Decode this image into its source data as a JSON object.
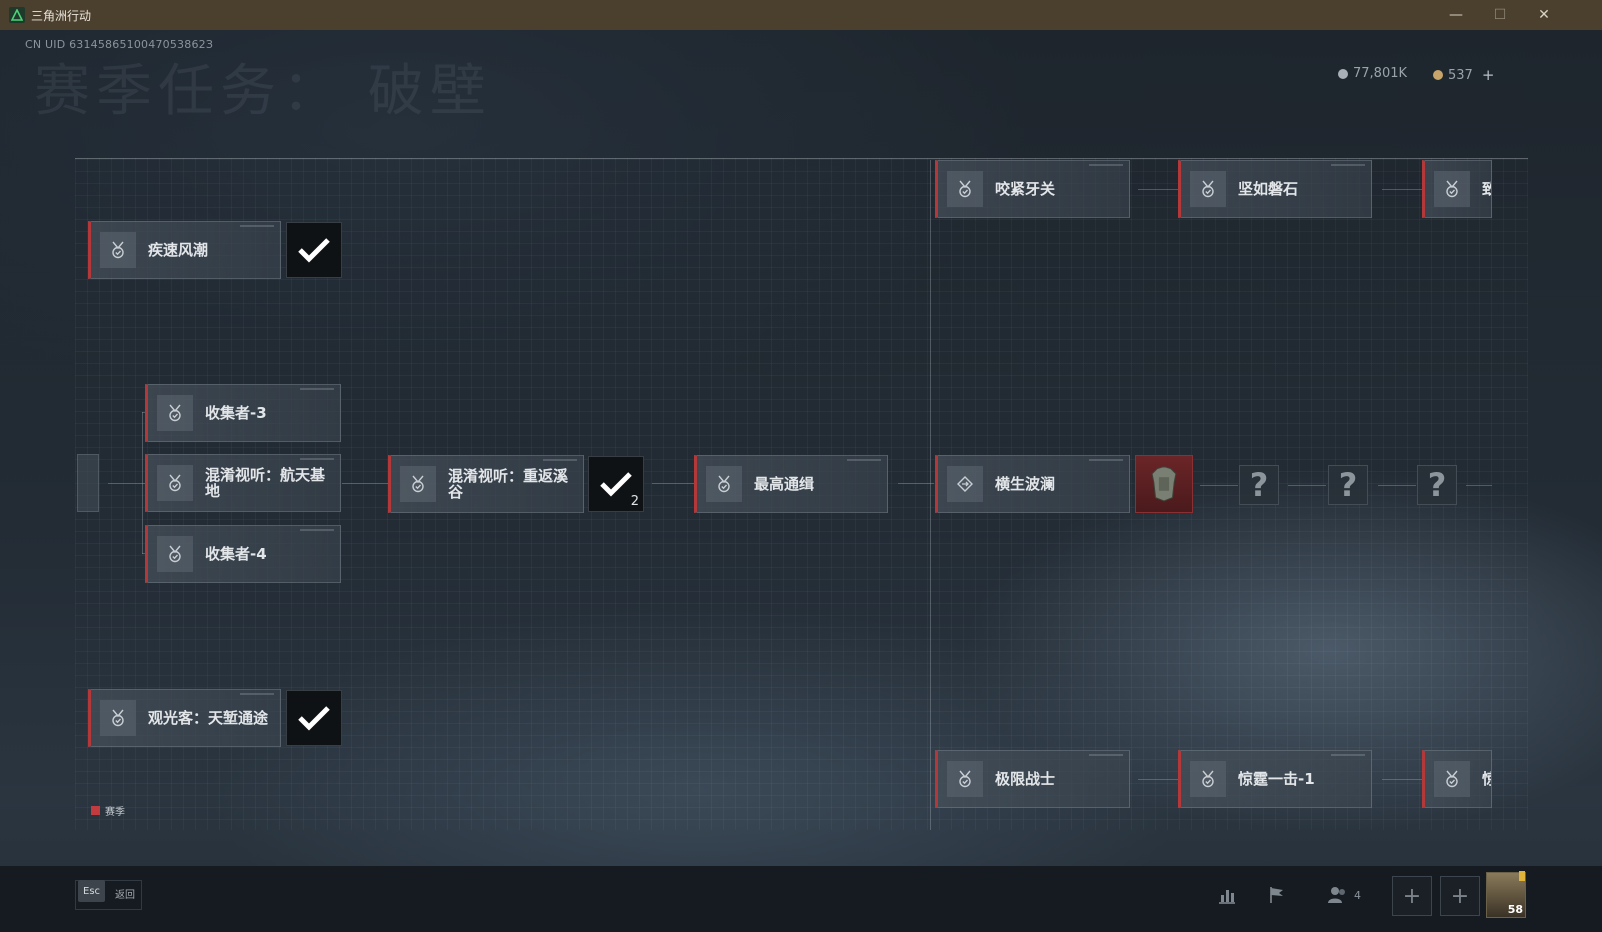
{
  "window": {
    "title": "三角洲行动",
    "minimize": "—",
    "maximize": "☐",
    "close": "✕"
  },
  "header": {
    "uid": "CN UID 6314586510047053862З",
    "page_title": "赛季任务： 破壁",
    "currency_a": "77,801K",
    "currency_b": "537",
    "add": "+"
  },
  "tasks": {
    "jisu": "疾速风潮",
    "shouji3": "收集者-3",
    "hunxiao_hangtian": "混淆视听：航天基地",
    "shouji4": "收集者-4",
    "hunxiao_chongfan": "混淆视听：重返溪谷",
    "zuigao": "最高通缉",
    "hengsheng": "横生波澜",
    "yaojin": "咬紧牙关",
    "jianru": "坚如磐石",
    "zhi": "致",
    "guanguang": "观光客：天堑通途",
    "jixian": "极限战士",
    "jingting1": "惊霆一击-1",
    "jing": "惊"
  },
  "check_count": "2",
  "question_mark": "?",
  "legend": {
    "label": "赛季",
    "color": "#c23c3f"
  },
  "bottom": {
    "esc": "Esc",
    "back": "返回",
    "squad_count": "4",
    "plus": "+",
    "level": "58"
  },
  "icons": {
    "task": "medal-check-icon",
    "special": "diamond-arrows-icon",
    "stats": "bar-chart-icon",
    "flag": "flag-icon",
    "squad": "people-icon"
  },
  "colors": {
    "accent_red": "#b2383a",
    "titlebar": "#4b3f2e"
  }
}
